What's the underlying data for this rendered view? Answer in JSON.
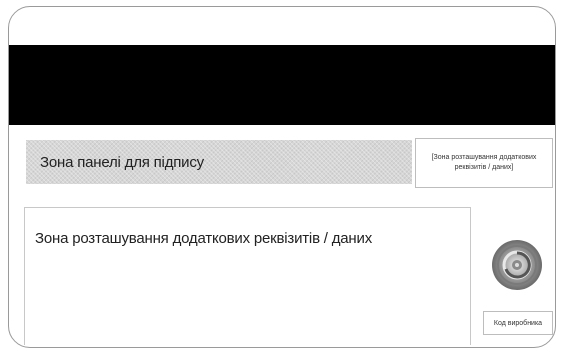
{
  "card": {
    "signature_zone_label": "Зона панелі для підпису",
    "details_zone_label": "Зона розташування додаткових реквізитів / даних",
    "small_zone_label": "[Зона розташування додаткових реквізитів / даних]",
    "vendor_code_label": "Код виробника",
    "hologram_icon": "hologram-icon",
    "colors": {
      "stripe": "#000000",
      "signature_panel": "#d6d6d6",
      "border": "#9a9a9a"
    }
  }
}
